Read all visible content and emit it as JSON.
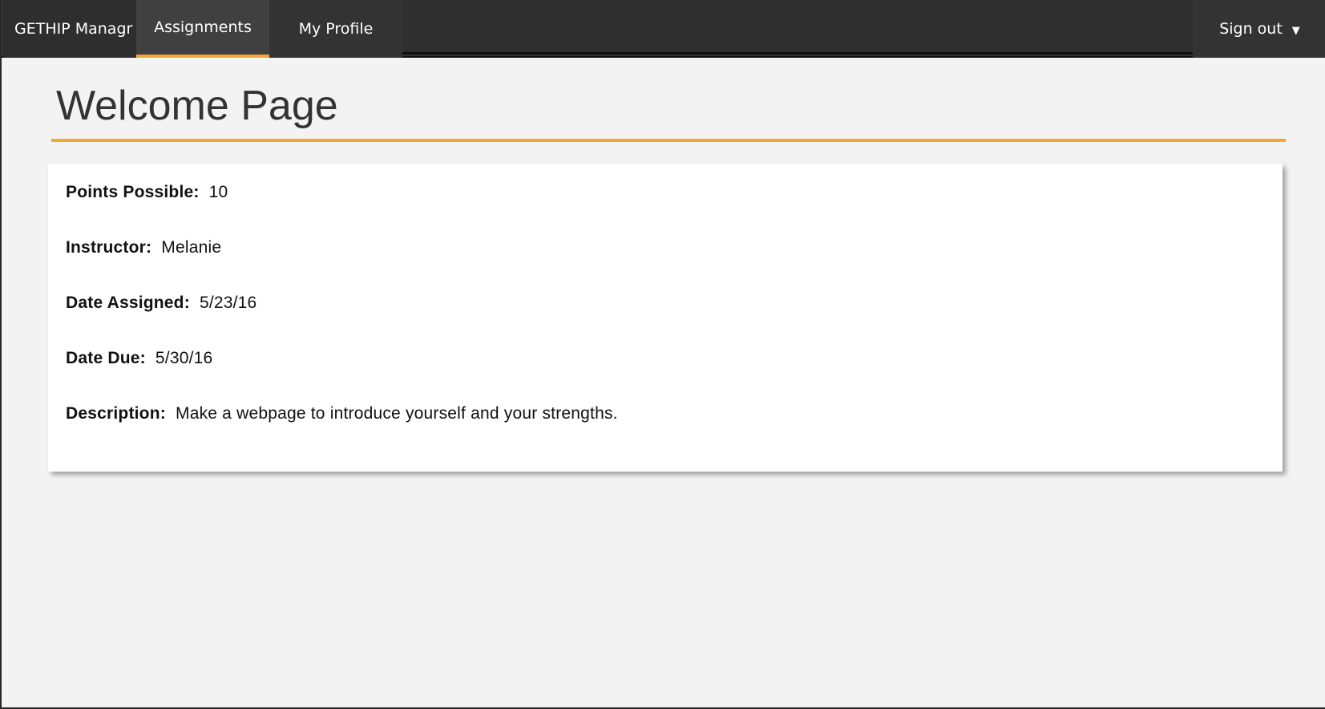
{
  "nav": {
    "brand": "GETHIP Managr",
    "tabs": [
      {
        "label": "Assignments",
        "active": true
      },
      {
        "label": "My Profile",
        "active": false
      }
    ],
    "signout_label": "Sign out",
    "signout_caret": "▼"
  },
  "page": {
    "title": "Welcome Page"
  },
  "assignment": {
    "fields": [
      {
        "label": "Points Possible:",
        "value": "10"
      },
      {
        "label": "Instructor:",
        "value": "Melanie"
      },
      {
        "label": "Date Assigned:",
        "value": "5/23/16"
      },
      {
        "label": "Date Due:",
        "value": "5/30/16"
      },
      {
        "label": "Description:",
        "value": "Make a webpage to introduce yourself and your strengths."
      }
    ]
  },
  "colors": {
    "nav_bg": "#333333",
    "accent": "#f5a733",
    "page_bg": "#f3f3f3",
    "card_bg": "#ffffff"
  }
}
